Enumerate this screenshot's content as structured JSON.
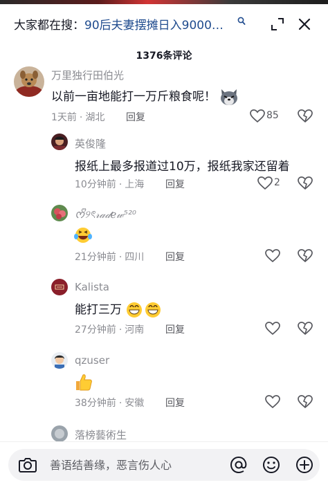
{
  "search": {
    "prefix": "大家都在搜：",
    "query": "90后夫妻摆摊日入9000…"
  },
  "comment_count": "1376条评论",
  "comments": [
    {
      "user": "万里独行田伯光",
      "text": "以前一亩地能打一万斤粮食呢！",
      "emoji": "wolf-face-sticker",
      "time": "1天前",
      "location": "湖北",
      "reply": "回复",
      "likes": "85"
    },
    {
      "user": "英俊隆",
      "text": "报纸上最多报道过10万，报纸我家还留着",
      "time": "10分钟前",
      "location": "上海",
      "reply": "回复",
      "likes": "2"
    },
    {
      "user": "ᰔᩚ୨ৎ𝓇𝒶𝒹ℯ𝓌⁵²⁰",
      "text": "",
      "emoji": "laughing-tears-emoji",
      "time": "21分钟前",
      "location": "四川",
      "reply": "回复"
    },
    {
      "user": "Kalista",
      "text": "能打三万",
      "emoji": "grinning-emoji",
      "time": "27分钟前",
      "location": "河南",
      "reply": "回复"
    },
    {
      "user": "qzuser",
      "text": "",
      "emoji": "thumbs-up-emoji",
      "time": "38分钟前",
      "location": "安徽",
      "reply": "回复"
    },
    {
      "user": "落榜藝術生"
    }
  ],
  "input": {
    "placeholder": "善语结善缘，恶言伤人心"
  },
  "colors": {
    "search_query": "#1f4b8e",
    "meta_gray": "#8a8b91",
    "input_bg": "#f2f2f4"
  },
  "icons": [
    "search-icon",
    "collapse-icon",
    "close-icon",
    "heart-icon",
    "broken-heart-icon",
    "camera-icon",
    "at-icon",
    "smiley-icon",
    "plus-icon"
  ]
}
